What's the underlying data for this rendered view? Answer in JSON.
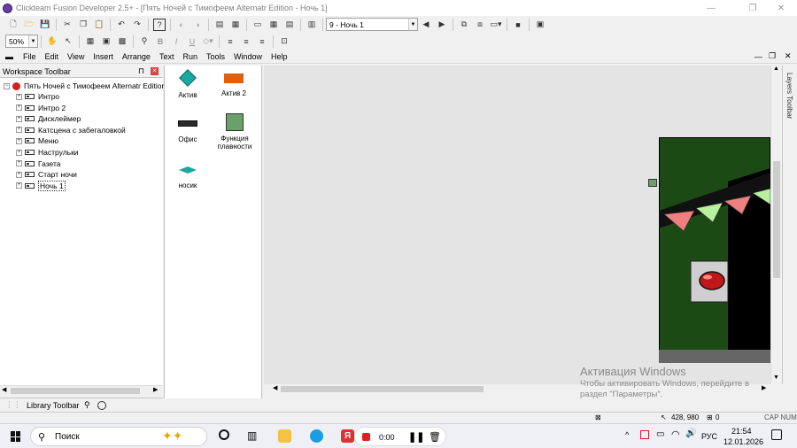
{
  "window": {
    "title": "Clickteam Fusion Developer 2.5+ - [Пять Ночей с Тимофеем Alternatr Edition - Ночь 1]"
  },
  "toolbar": {
    "frame_select": "9 - Ночь 1",
    "zoom": "50%"
  },
  "menu": [
    "File",
    "Edit",
    "View",
    "Insert",
    "Arrange",
    "Text",
    "Run",
    "Tools",
    "Window",
    "Help"
  ],
  "workspace": {
    "title": "Workspace Toolbar",
    "pin": "⊓",
    "close": "✕",
    "root": "Пять Ночей с Тимофеем Alternatr Edition",
    "frames": [
      "Интро",
      "Интро 2",
      "Дисклеймер",
      "Катсцена с забегаловкой",
      "Меню",
      "Наструльки",
      "Газета",
      "Старт ночи",
      "Ночь 1"
    ],
    "selected": "Ночь 1"
  },
  "objects": [
    {
      "name": "Актив",
      "icon": "diamond-icon"
    },
    {
      "name": "Актив 2",
      "icon": "orange-rect-icon"
    },
    {
      "name": "Офис",
      "icon": "office-icon"
    },
    {
      "name": "Функция плавности",
      "icon": "extension-icon"
    },
    {
      "name": "носик",
      "icon": "nose-icon"
    }
  ],
  "library": {
    "title": "Library Toolbar"
  },
  "layers": {
    "title": "Layers Toolbar"
  },
  "watermark": {
    "line1": "Активация Windows",
    "line2": "Чтобы активировать Windows, перейдите в",
    "line3": "раздел \"Параметры\"."
  },
  "status": {
    "coords": "428, 980",
    "count": "0",
    "caps": "CAP NUM"
  },
  "taskbar": {
    "search": "Поиск",
    "rec_time": "0:00",
    "lang": "РУС",
    "time": "21:54",
    "date": "12.01.2026"
  },
  "colors": {
    "scene_green": "#1c4a14",
    "accent_blue": "#0078d4",
    "record_red": "#e02020"
  }
}
